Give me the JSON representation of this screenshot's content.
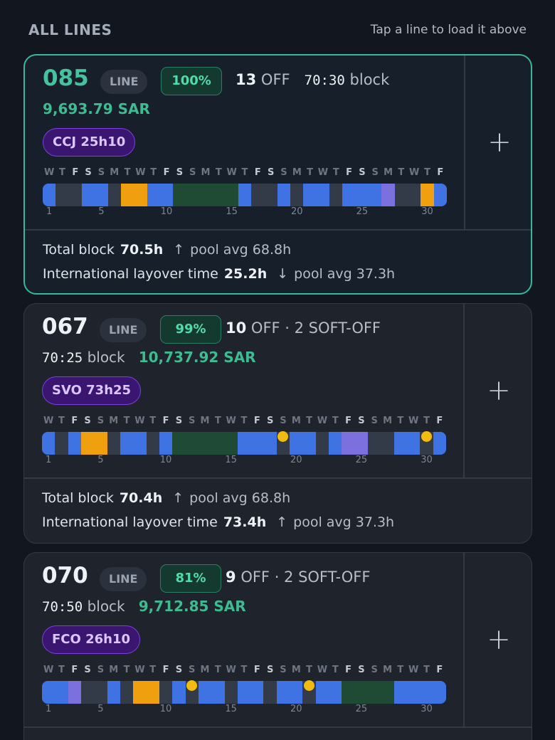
{
  "header": {
    "title": "ALL LINES",
    "hint": "Tap a line to load it above"
  },
  "calendar": {
    "weekdays": [
      "W",
      "T",
      "F",
      "S",
      "S",
      "M",
      "T",
      "W",
      "T",
      "F",
      "S",
      "S",
      "M",
      "T",
      "W",
      "T",
      "F",
      "S",
      "S",
      "M",
      "T",
      "W",
      "T",
      "F",
      "S",
      "S",
      "M",
      "T",
      "W",
      "T",
      "F"
    ],
    "weekend_indices": [
      2,
      3,
      9,
      10,
      16,
      17,
      23,
      24,
      30
    ],
    "tick_days": [
      1,
      5,
      10,
      15,
      20,
      25,
      30
    ]
  },
  "cards": [
    {
      "number": "085",
      "type": "LINE",
      "match": "100%",
      "off_count": "13",
      "off_label": "OFF",
      "block_time": "70:30",
      "block_label": "block",
      "soft_off": "",
      "pay": "9,693.79 SAR",
      "trip": "CCJ 25h10",
      "selected": true,
      "segments": [
        [
          1,
          1,
          "blue"
        ],
        [
          4,
          5,
          "blue"
        ],
        [
          7,
          8,
          "orange"
        ],
        [
          9,
          10,
          "blue"
        ],
        [
          11,
          15,
          "green"
        ],
        [
          16,
          16,
          "blue"
        ],
        [
          19,
          19,
          "blue"
        ],
        [
          21,
          22,
          "blue"
        ],
        [
          24,
          26,
          "blue"
        ],
        [
          27,
          27,
          "purple"
        ],
        [
          30,
          30,
          "orange"
        ],
        [
          31,
          31,
          "blue"
        ]
      ],
      "dots": [],
      "stats": [
        {
          "label": "Total block",
          "value": "70.5h",
          "arrow": "↑",
          "pool": "pool avg 68.8h"
        },
        {
          "label": "International layover time",
          "value": "25.2h",
          "arrow": "↓",
          "pool": "pool avg 37.3h"
        }
      ]
    },
    {
      "number": "067",
      "type": "LINE",
      "match": "99%",
      "off_count": "10",
      "off_label": "OFF",
      "block_time": "70:25",
      "block_label": "block",
      "soft_off": "· 2 SOFT-OFF",
      "pay": "10,737.92 SAR",
      "trip": "SVO 73h25",
      "selected": false,
      "segments": [
        [
          1,
          1,
          "blue"
        ],
        [
          3,
          3,
          "blue"
        ],
        [
          4,
          5,
          "orange"
        ],
        [
          7,
          8,
          "blue"
        ],
        [
          10,
          10,
          "blue"
        ],
        [
          11,
          15,
          "green"
        ],
        [
          16,
          18,
          "blue"
        ],
        [
          20,
          21,
          "blue"
        ],
        [
          23,
          23,
          "blue"
        ],
        [
          24,
          25,
          "purple"
        ],
        [
          28,
          29,
          "blue"
        ],
        [
          31,
          31,
          "blue"
        ]
      ],
      "dots": [
        19,
        30
      ],
      "stats": [
        {
          "label": "Total block",
          "value": "70.4h",
          "arrow": "↑",
          "pool": "pool avg 68.8h"
        },
        {
          "label": "International layover time",
          "value": "73.4h",
          "arrow": "↑",
          "pool": "pool avg 37.3h"
        }
      ]
    },
    {
      "number": "070",
      "type": "LINE",
      "match": "81%",
      "off_count": "9",
      "off_label": "OFF",
      "block_time": "70:50",
      "block_label": "block",
      "soft_off": "· 2 SOFT-OFF",
      "pay": "9,712.85 SAR",
      "trip": "FCO 26h10",
      "selected": false,
      "segments": [
        [
          1,
          2,
          "blue"
        ],
        [
          3,
          3,
          "purple"
        ],
        [
          6,
          6,
          "blue"
        ],
        [
          8,
          9,
          "orange"
        ],
        [
          11,
          11,
          "blue"
        ],
        [
          13,
          14,
          "blue"
        ],
        [
          16,
          17,
          "blue"
        ],
        [
          19,
          20,
          "blue"
        ],
        [
          22,
          23,
          "blue"
        ],
        [
          24,
          27,
          "green"
        ],
        [
          28,
          31,
          "blue"
        ]
      ],
      "dots": [
        12,
        21
      ],
      "stats": []
    }
  ]
}
